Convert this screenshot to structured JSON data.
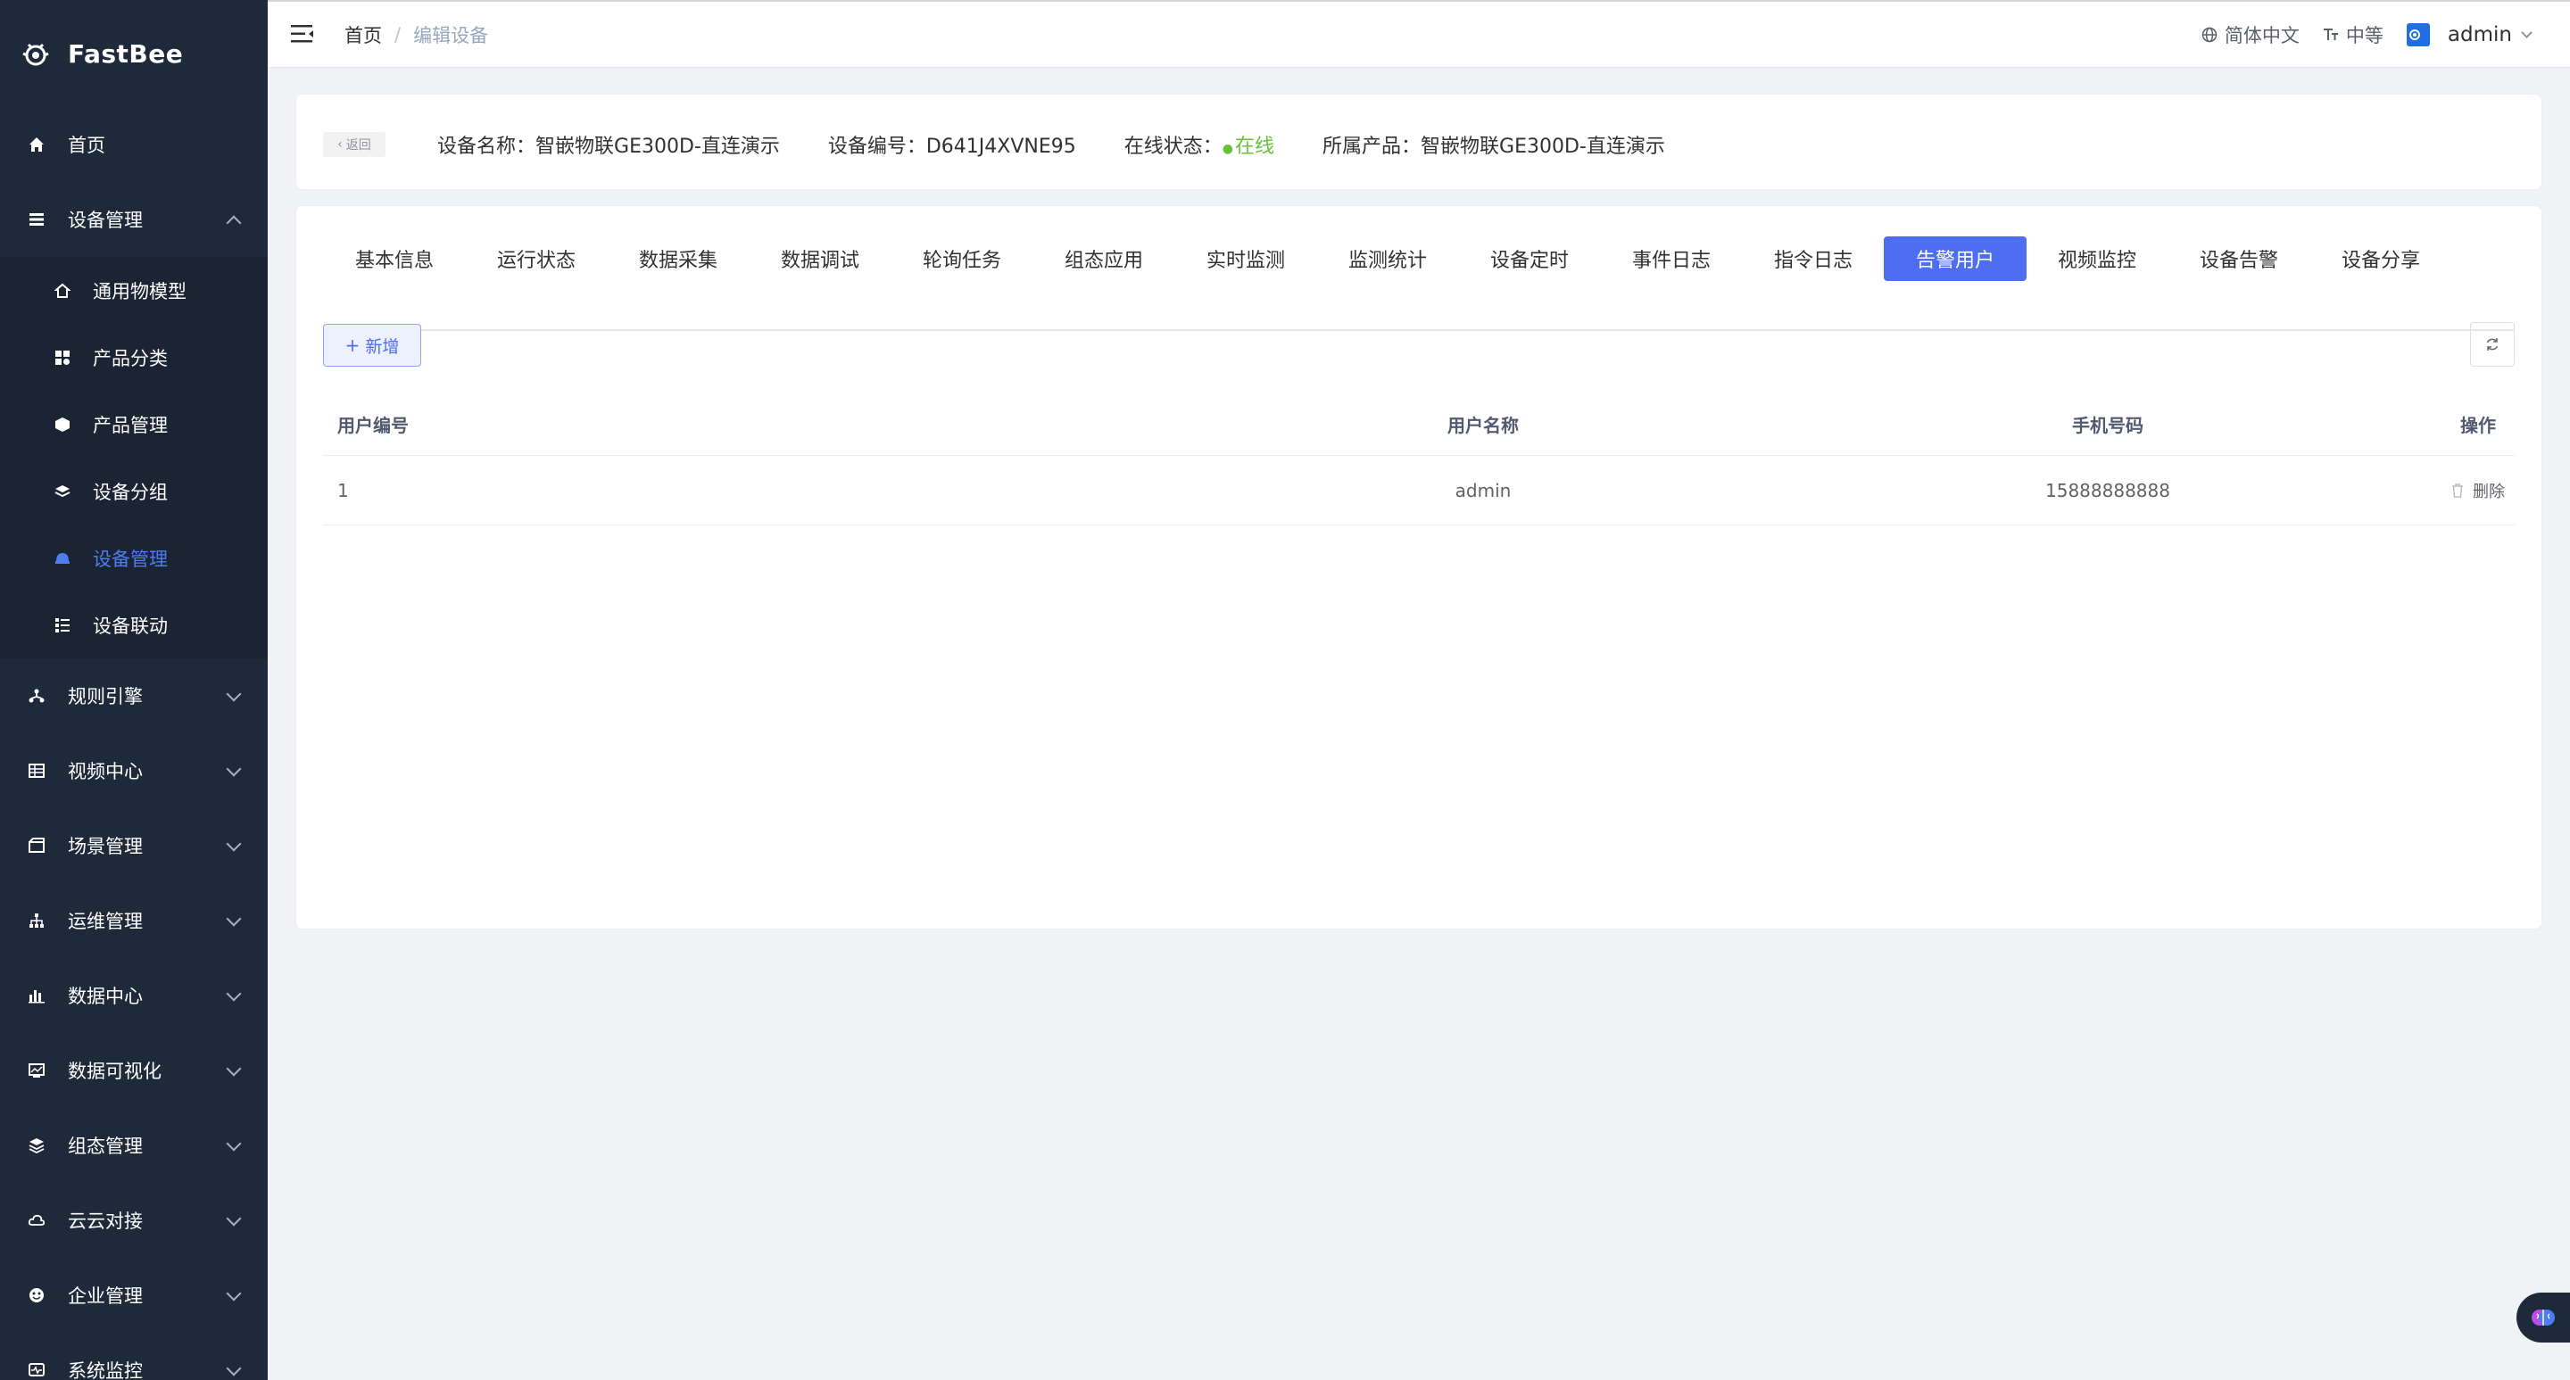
{
  "app": {
    "name": "FastBee"
  },
  "sidebar": {
    "items": [
      {
        "label": "首页",
        "icon": "home-icon",
        "expanded": null
      },
      {
        "label": "设备管理",
        "icon": "device-icon",
        "expanded": true
      },
      {
        "label": "规则引擎",
        "icon": "rule-icon",
        "expanded": false
      },
      {
        "label": "视频中心",
        "icon": "video-icon",
        "expanded": false
      },
      {
        "label": "场景管理",
        "icon": "scene-icon",
        "expanded": false
      },
      {
        "label": "运维管理",
        "icon": "ops-icon",
        "expanded": false
      },
      {
        "label": "数据中心",
        "icon": "data-icon",
        "expanded": false
      },
      {
        "label": "数据可视化",
        "icon": "visual-icon",
        "expanded": false
      },
      {
        "label": "组态管理",
        "icon": "scada-icon",
        "expanded": false
      },
      {
        "label": "云云对接",
        "icon": "cloud-icon",
        "expanded": false
      },
      {
        "label": "企业管理",
        "icon": "company-icon",
        "expanded": false
      },
      {
        "label": "系统监控",
        "icon": "monitor-icon",
        "expanded": false
      }
    ],
    "sub_items": [
      {
        "label": "通用物模型",
        "icon": "model-icon",
        "active": false
      },
      {
        "label": "产品分类",
        "icon": "category-icon",
        "active": false
      },
      {
        "label": "产品管理",
        "icon": "product-icon",
        "active": false
      },
      {
        "label": "设备分组",
        "icon": "group-icon",
        "active": false
      },
      {
        "label": "设备管理",
        "icon": "device-mgmt-icon",
        "active": true
      },
      {
        "label": "设备联动",
        "icon": "linkage-icon",
        "active": false
      }
    ]
  },
  "header": {
    "breadcrumb_home": "首页",
    "breadcrumb_separator": "/",
    "breadcrumb_current": "编辑设备",
    "language": "简体中文",
    "font_size": "中等",
    "username": "admin"
  },
  "device_info": {
    "back_label": "返回",
    "name_label": "设备名称：",
    "name_value": "智嵌物联GE300D-直连演示",
    "serial_label": "设备编号：",
    "serial_value": "D641J4XVNE95",
    "status_label": "在线状态：",
    "status_value": "在线",
    "product_label": "所属产品：",
    "product_value": "智嵌物联GE300D-直连演示"
  },
  "tabs": [
    {
      "label": "基本信息",
      "active": false
    },
    {
      "label": "运行状态",
      "active": false
    },
    {
      "label": "数据采集",
      "active": false
    },
    {
      "label": "数据调试",
      "active": false
    },
    {
      "label": "轮询任务",
      "active": false
    },
    {
      "label": "组态应用",
      "active": false
    },
    {
      "label": "实时监测",
      "active": false
    },
    {
      "label": "监测统计",
      "active": false
    },
    {
      "label": "设备定时",
      "active": false
    },
    {
      "label": "事件日志",
      "active": false
    },
    {
      "label": "指令日志",
      "active": false
    },
    {
      "label": "告警用户",
      "active": true
    },
    {
      "label": "视频监控",
      "active": false
    },
    {
      "label": "设备告警",
      "active": false
    },
    {
      "label": "设备分享",
      "active": false
    }
  ],
  "toolbar": {
    "add_label": "新增"
  },
  "table": {
    "headers": {
      "id": "用户编号",
      "name": "用户名称",
      "phone": "手机号码",
      "op": "操作"
    },
    "rows": [
      {
        "id": "1",
        "name": "admin",
        "phone": "15888888888",
        "op": "删除"
      }
    ]
  },
  "colors": {
    "accent": "#4d6ef0",
    "sidebar_bg": "#1e2a3a",
    "online": "#67c23a"
  }
}
